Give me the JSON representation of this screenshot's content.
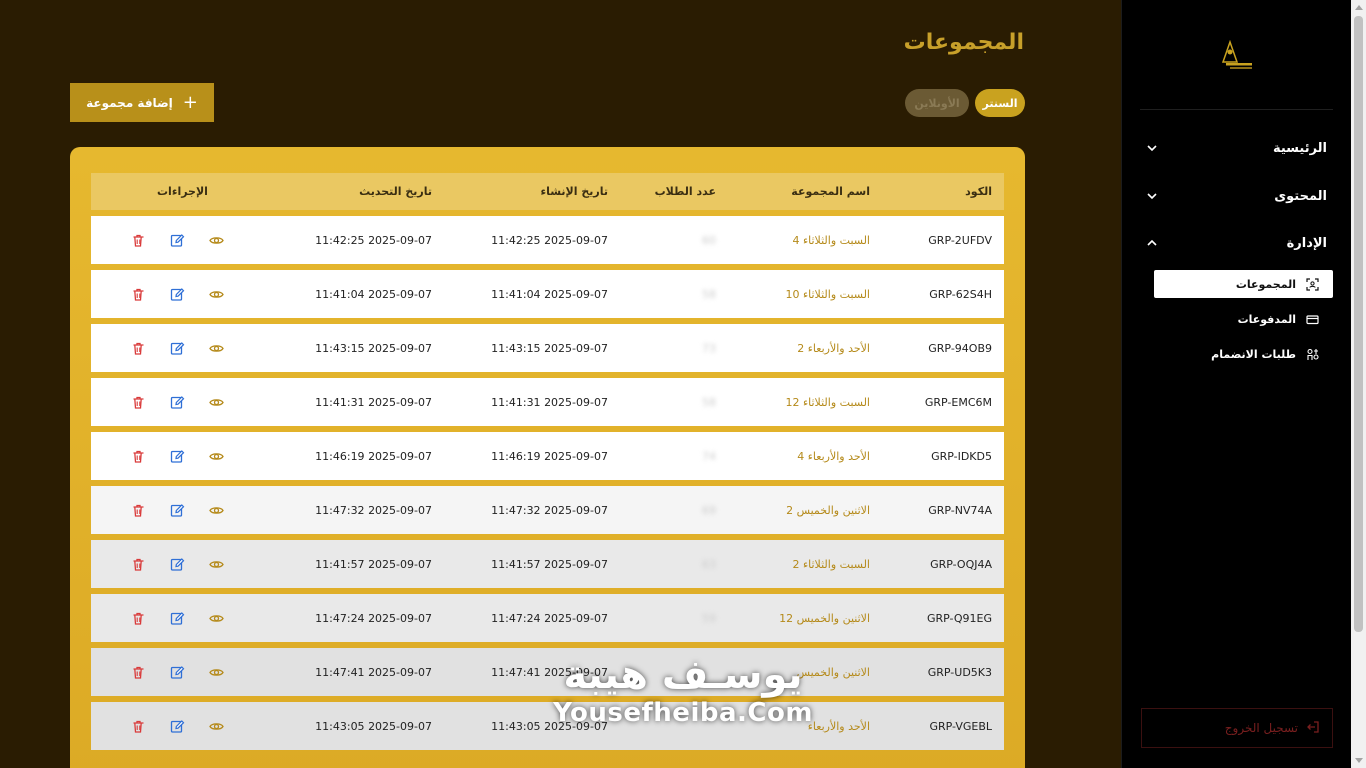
{
  "page": {
    "title": "المجموعات"
  },
  "toolbar": {
    "add_label": "إضافة مجموعة"
  },
  "filters": [
    {
      "label": "السنتر",
      "active": true
    },
    {
      "label": "الأونلاين",
      "active": false
    }
  ],
  "table": {
    "headers": {
      "code": "الكود",
      "name": "اسم المجموعة",
      "count": "عدد الطلاب",
      "created": "تاريخ الإنشاء",
      "updated": "تاريخ التحديث",
      "actions": "الإجراءات"
    },
    "rows": [
      {
        "code": "GRP-2UFDV",
        "name": "السبت والثلاثاء 4",
        "count": "60",
        "created": "2025-09-07 11:42:25",
        "updated": "2025-09-07 11:42:25"
      },
      {
        "code": "GRP-62S4H",
        "name": "السبت والثلاثاء 10",
        "count": "58",
        "created": "2025-09-07 11:41:04",
        "updated": "2025-09-07 11:41:04"
      },
      {
        "code": "GRP-94OB9",
        "name": "الأحد والأربعاء 2",
        "count": "73",
        "created": "2025-09-07 11:43:15",
        "updated": "2025-09-07 11:43:15"
      },
      {
        "code": "GRP-EMC6M",
        "name": "السبت والثلاثاء 12",
        "count": "58",
        "created": "2025-09-07 11:41:31",
        "updated": "2025-09-07 11:41:31"
      },
      {
        "code": "GRP-IDKD5",
        "name": "الأحد والأربعاء 4",
        "count": "74",
        "created": "2025-09-07 11:46:19",
        "updated": "2025-09-07 11:46:19"
      },
      {
        "code": "GRP-NV74A",
        "name": "الاثنين والخميس 2",
        "count": "69",
        "created": "2025-09-07 11:47:32",
        "updated": "2025-09-07 11:47:32"
      },
      {
        "code": "GRP-OQJ4A",
        "name": "السبت والثلاثاء 2",
        "count": "63",
        "created": "2025-09-07 11:41:57",
        "updated": "2025-09-07 11:41:57"
      },
      {
        "code": "GRP-Q91EG",
        "name": "الاثنين والخميس 12",
        "count": "59",
        "created": "2025-09-07 11:47:24",
        "updated": "2025-09-07 11:47:24"
      },
      {
        "code": "GRP-UD5K3",
        "name": "الاثنين والخميس",
        "count": "",
        "created": "2025-09-07 11:47:41",
        "updated": "2025-09-07 11:47:41"
      },
      {
        "code": "GRP-VGEBL",
        "name": "الأحد والأربعاء",
        "count": "",
        "created": "2025-09-07 11:43:05",
        "updated": "2025-09-07 11:43:05"
      }
    ]
  },
  "sidebar": {
    "sections": [
      {
        "label": "الرئيسية",
        "expanded": false
      },
      {
        "label": "المحتوى",
        "expanded": false
      },
      {
        "label": "الإدارة",
        "expanded": true
      }
    ],
    "admin_items": [
      {
        "label": "المجموعات",
        "icon": "groups-scan-icon",
        "active": true
      },
      {
        "label": "المدفوعات",
        "icon": "credit-card-icon",
        "active": false
      },
      {
        "label": "طلبات الانضمام",
        "icon": "join-requests-icon",
        "active": false
      }
    ],
    "logout_label": "تسجيل الخروج"
  },
  "watermark": {
    "arabic": "يوسـف هيبة",
    "english": "Yousefheiba.Com"
  },
  "colors": {
    "accent": "#c9a21f",
    "title": "#c8a02a",
    "background": "#2a1c02",
    "delete": "#d93a3a",
    "edit": "#2f6fd6",
    "view": "#b58a1a"
  }
}
